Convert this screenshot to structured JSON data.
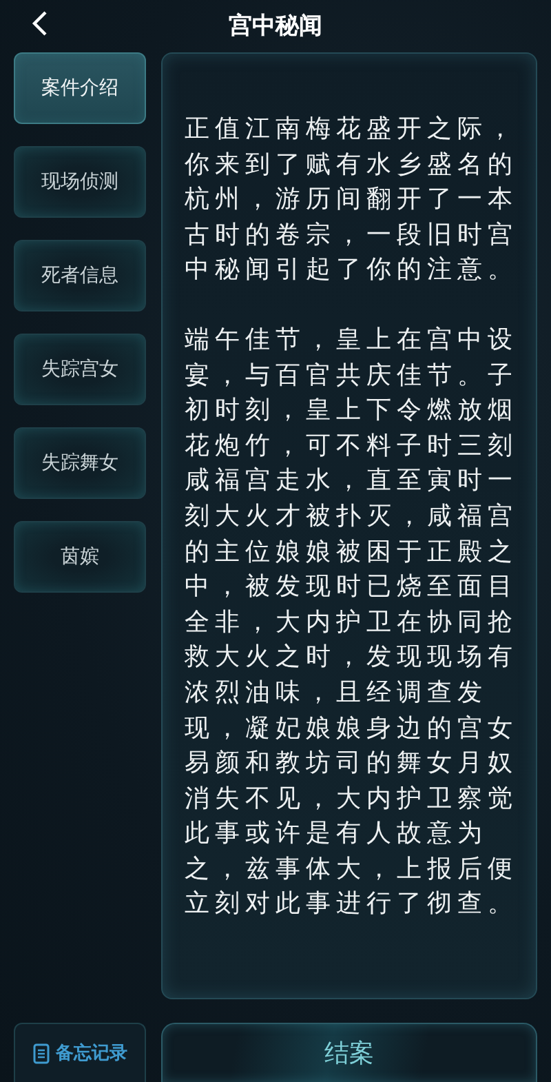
{
  "header": {
    "title": "宫中秘闻"
  },
  "sidebar": {
    "items": [
      {
        "label": "案件介绍",
        "selected": true
      },
      {
        "label": "现场侦测",
        "selected": false
      },
      {
        "label": "死者信息",
        "selected": false
      },
      {
        "label": "失踪宫女",
        "selected": false
      },
      {
        "label": "失踪舞女",
        "selected": false
      },
      {
        "label": "茵嫔",
        "selected": false
      }
    ]
  },
  "content": {
    "paragraphs": [
      "正值江南梅花盛开之际，你来到了赋有水乡盛名的杭州，游历间翻开了一本古时的卷宗，一段旧时宫中秘闻引起了你的注意。",
      "端午佳节，皇上在宫中设宴，与百官共庆佳节。子初时刻，皇上下令燃放烟花炮竹，可不料子时三刻咸福宫走水，直至寅时一刻大火才被扑灭，咸福宫的主位娘娘被困于正殿之中，被发现时已烧至面目全非，大内护卫在协同抢救大火之时，发现现场有浓烈油味，且经调查发现，凝妃娘娘身边的宫女易颜和教坊司的舞女月奴消失不见，大内护卫察觉此事或许是有人故意为之，兹事体大，上报后便立刻对此事进行了彻查。"
    ]
  },
  "footer": {
    "memo_button": "备忘记录",
    "close_case_button": "结案"
  }
}
